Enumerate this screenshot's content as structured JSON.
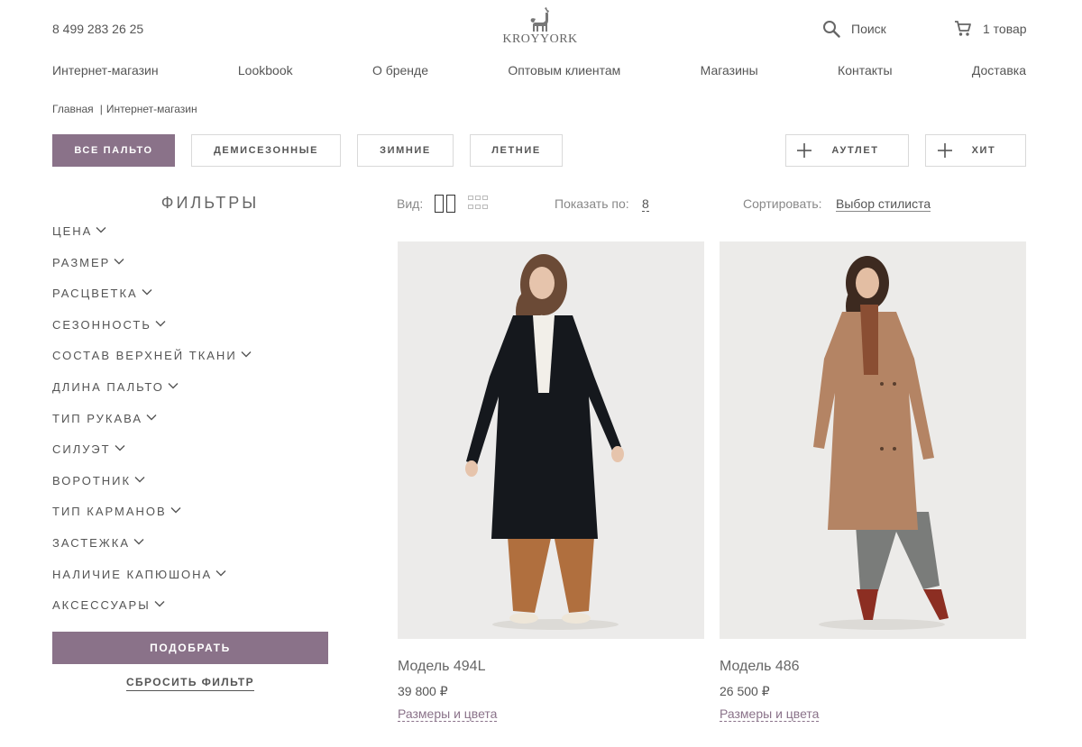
{
  "header": {
    "phone": "8 499 283 26 25",
    "logo_text": "KROYYORK",
    "search_label": "Поиск",
    "cart_label": "1 товар"
  },
  "nav": {
    "items": [
      "Интернет-магазин",
      "Lookbook",
      "О бренде",
      "Оптовым клиентам",
      "Магазины",
      "Контакты",
      "Доставка"
    ]
  },
  "breadcrumb": {
    "home": "Главная",
    "separator": "|",
    "current": "Интернет-магазин"
  },
  "categories": {
    "items": [
      {
        "label": "ВСЕ ПАЛЬТО",
        "active": true
      },
      {
        "label": "ДЕМИСЕЗОННЫЕ",
        "active": false
      },
      {
        "label": "ЗИМНИЕ",
        "active": false
      },
      {
        "label": "ЛЕТНИЕ",
        "active": false
      }
    ],
    "tags": [
      {
        "label": "АУТЛЕТ",
        "icon": "plus-icon"
      },
      {
        "label": "ХИТ",
        "icon": "plus-icon"
      }
    ]
  },
  "filters": {
    "title": "ФИЛЬТРЫ",
    "items": [
      "ЦЕНА",
      "РАЗМЕР",
      "РАСЦВЕТКА",
      "СЕЗОННОСТЬ",
      "СОСТАВ ВЕРХНЕЙ ТКАНИ",
      "ДЛИНА ПАЛЬТО",
      "ТИП РУКАВА",
      "СИЛУЭТ",
      "ВОРОТНИК",
      "ТИП КАРМАНОВ",
      "ЗАСТЕЖКА",
      "НАЛИЧИЕ КАПЮШОНА",
      "АКСЕССУАРЫ"
    ],
    "apply_label": "ПОДОБРАТЬ",
    "reset_label": "СБРОСИТЬ ФИЛЬТР"
  },
  "toolbar": {
    "view_label": "Вид:",
    "show_label": "Показать по:",
    "show_value": "8",
    "sort_label": "Сортировать:",
    "sort_value": "Выбор стилиста"
  },
  "products": [
    {
      "name": "Модель 494L",
      "price": "39 800 ₽",
      "sizes_link": "Размеры и цвета",
      "coat_color": "#15181d",
      "bg_color": "#ecebea"
    },
    {
      "name": "Модель 486",
      "price": "26 500 ₽",
      "sizes_link": "Размеры и цвета",
      "coat_color": "#b48464",
      "bg_color": "#ecebe9"
    }
  ],
  "colors": {
    "accent": "#8a7289",
    "text": "#555555"
  }
}
